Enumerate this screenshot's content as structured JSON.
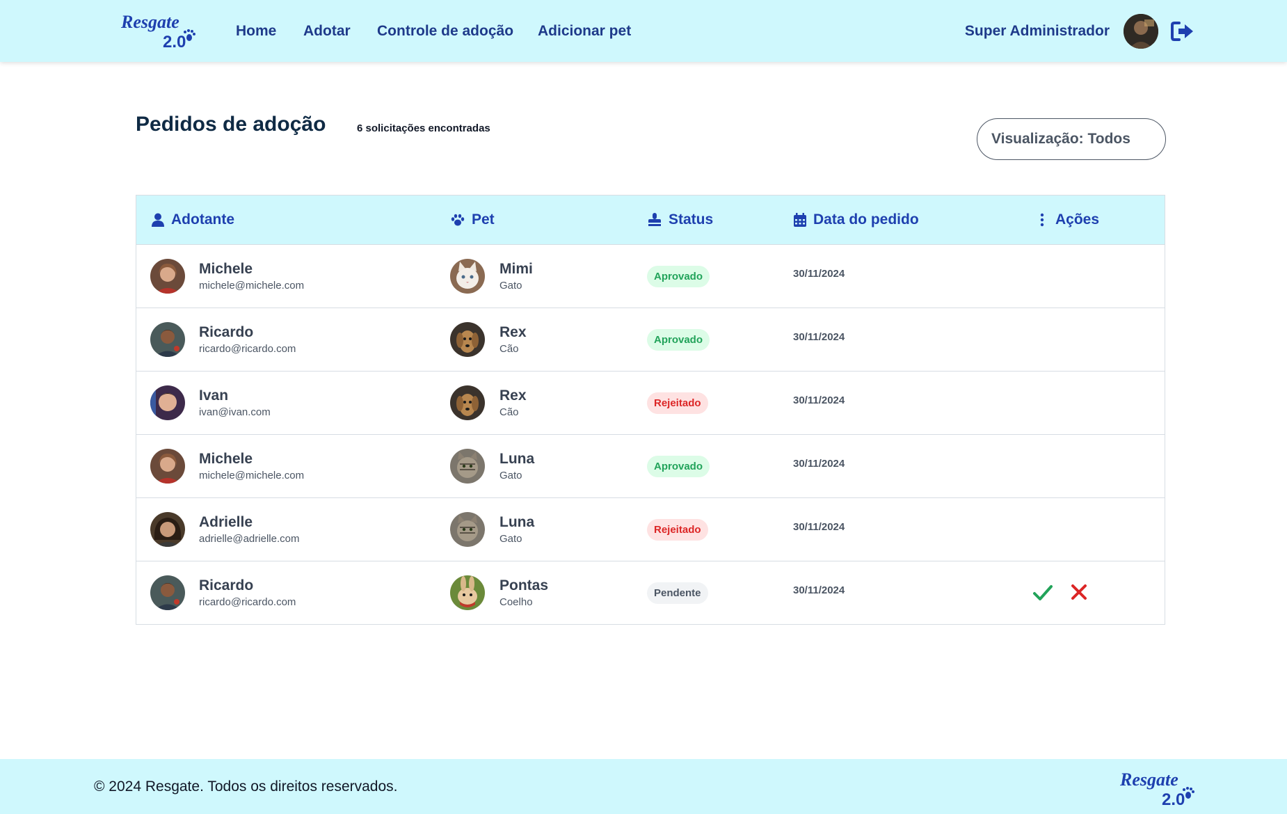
{
  "header": {
    "logo_text_top": "Resgate",
    "logo_text_version": "2.0",
    "nav": {
      "home": "Home",
      "adotar": "Adotar",
      "controle": "Controle de adoção",
      "adicionar": "Adicionar pet"
    },
    "user_name": "Super Administrador"
  },
  "page": {
    "title": "Pedidos de adoção",
    "count_label": "6 solicitações encontradas",
    "view_select": "Visualização: Todos"
  },
  "table": {
    "headers": {
      "adotante": "Adotante",
      "pet": "Pet",
      "status": "Status",
      "data": "Data do pedido",
      "acoes": "Ações"
    },
    "rows": [
      {
        "adotante": "Michele",
        "email": "michele@michele.com",
        "pet": "Mimi",
        "especie": "Gato",
        "status": "Aprovado",
        "data": "30/11/2024"
      },
      {
        "adotante": "Ricardo",
        "email": "ricardo@ricardo.com",
        "pet": "Rex",
        "especie": "Cão",
        "status": "Aprovado",
        "data": "30/11/2024"
      },
      {
        "adotante": "Ivan",
        "email": "ivan@ivan.com",
        "pet": "Rex",
        "especie": "Cão",
        "status": "Rejeitado",
        "data": "30/11/2024"
      },
      {
        "adotante": "Michele",
        "email": "michele@michele.com",
        "pet": "Luna",
        "especie": "Gato",
        "status": "Aprovado",
        "data": "30/11/2024"
      },
      {
        "adotante": "Adrielle",
        "email": "adrielle@adrielle.com",
        "pet": "Luna",
        "especie": "Gato",
        "status": "Rejeitado",
        "data": "30/11/2024"
      },
      {
        "adotante": "Ricardo",
        "email": "ricardo@ricardo.com",
        "pet": "Pontas",
        "especie": "Coelho",
        "status": "Pendente",
        "data": "30/11/2024"
      }
    ]
  },
  "footer": {
    "copyright": "© 2024 Resgate. Todos os direitos reservados."
  },
  "colors": {
    "header_bg": "#cff8fd",
    "brand_blue": "#1e3a8a",
    "approved": "#22a35a",
    "rejected": "#dc2626"
  }
}
